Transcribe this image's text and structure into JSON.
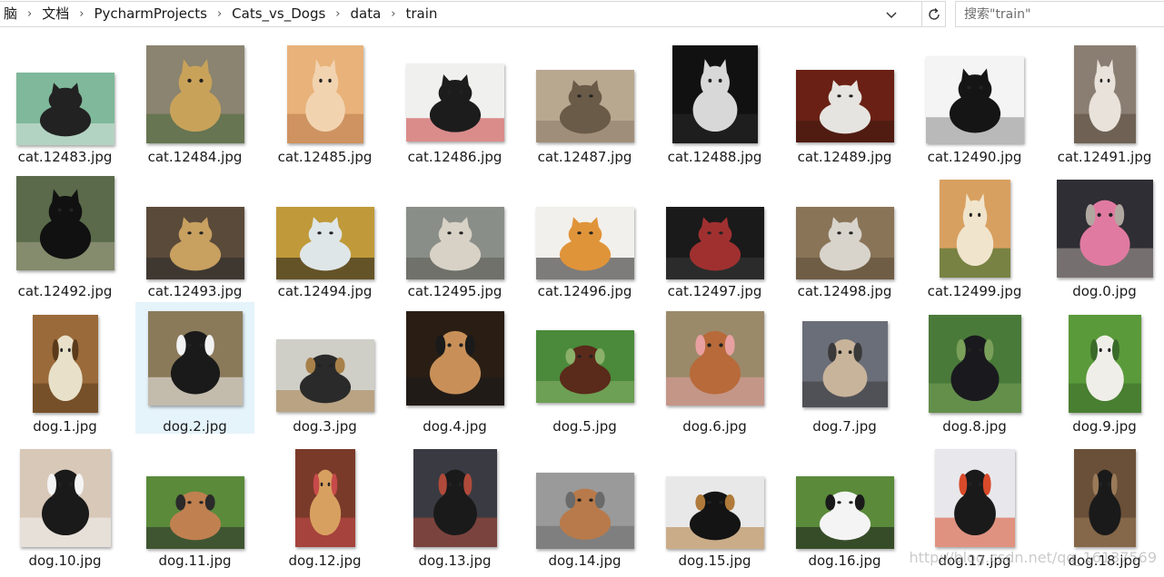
{
  "breadcrumb": [
    "脑",
    "文档",
    "PycharmProjects",
    "Cats_vs_Dogs",
    "data",
    "train"
  ],
  "search": {
    "placeholder": "搜索\"train\""
  },
  "watermark": "http://blog.csdn.net/qq_16137569",
  "colors": {
    "selection": "#e5f3fb",
    "border": "#d9d9d9",
    "background": "#ffffff"
  },
  "files": [
    {
      "name": "cat.12483.jpg",
      "palette": [
        "#7fb89a",
        "#222222",
        "#dfe9e4"
      ]
    },
    {
      "name": "cat.12484.jpg",
      "palette": [
        "#8a8470",
        "#c9a25a",
        "#4a6a3a"
      ]
    },
    {
      "name": "cat.12485.jpg",
      "palette": [
        "#e8b27a",
        "#f2d3b0",
        "#b87a4a"
      ]
    },
    {
      "name": "cat.12486.jpg",
      "palette": [
        "#f0f0ee",
        "#1c1c1c",
        "#c83a3a"
      ]
    },
    {
      "name": "cat.12487.jpg",
      "palette": [
        "#b8a890",
        "#6a5a48",
        "#8a7a68"
      ]
    },
    {
      "name": "cat.12488.jpg",
      "palette": [
        "#111111",
        "#d8d8d8",
        "#2a2a2a"
      ]
    },
    {
      "name": "cat.12489.jpg",
      "palette": [
        "#6a2014",
        "#e6e4e0",
        "#3a1a10"
      ]
    },
    {
      "name": "cat.12490.jpg",
      "palette": [
        "#f4f4f4",
        "#151515",
        "#888888"
      ]
    },
    {
      "name": "cat.12491.jpg",
      "palette": [
        "#8a7e72",
        "#e8e2da",
        "#5a4a3e"
      ]
    },
    {
      "name": "cat.12492.jpg",
      "palette": [
        "#5a6a4a",
        "#111111",
        "#a9a58a"
      ]
    },
    {
      "name": "cat.12493.jpg",
      "palette": [
        "#5a4a3a",
        "#c8a060",
        "#2a2a2a"
      ]
    },
    {
      "name": "cat.12494.jpg",
      "palette": [
        "#c09a3a",
        "#dfe6e8",
        "#1a1a1a"
      ]
    },
    {
      "name": "cat.12495.jpg",
      "palette": [
        "#8a8e88",
        "#d8d2c6",
        "#5a5a52"
      ]
    },
    {
      "name": "cat.12496.jpg",
      "palette": [
        "#f2f0ec",
        "#e0943a",
        "#1e1e1e"
      ]
    },
    {
      "name": "cat.12497.jpg",
      "palette": [
        "#1a1a1a",
        "#a03030",
        "#3a3a3a"
      ]
    },
    {
      "name": "cat.12498.jpg",
      "palette": [
        "#8a7458",
        "#d8d4cc",
        "#5a4a36"
      ]
    },
    {
      "name": "cat.12499.jpg",
      "palette": [
        "#d8a060",
        "#f0e4cc",
        "#2a6a2a"
      ]
    },
    {
      "name": "dog.0.jpg",
      "palette": [
        "#2e2e34",
        "#e07aa0",
        "#b0a8a0"
      ]
    },
    {
      "name": "dog.1.jpg",
      "palette": [
        "#9a6a3a",
        "#e8e0c8",
        "#5a3a1a"
      ]
    },
    {
      "name": "dog.2.jpg",
      "palette": [
        "#8a7a5a",
        "#1a1a1a",
        "#f2f2f2"
      ]
    },
    {
      "name": "dog.3.jpg",
      "palette": [
        "#cfcfc8",
        "#2a2a2a",
        "#a8804a"
      ]
    },
    {
      "name": "dog.4.jpg",
      "palette": [
        "#2a1e14",
        "#c89058",
        "#1a1a1a"
      ]
    },
    {
      "name": "dog.5.jpg",
      "palette": [
        "#4a8a3a",
        "#5a2a1a",
        "#8ab06a"
      ]
    },
    {
      "name": "dog.6.jpg",
      "palette": [
        "#9a8a6a",
        "#b86a3a",
        "#e8a0a0"
      ]
    },
    {
      "name": "dog.7.jpg",
      "palette": [
        "#6a6e78",
        "#c8b49a",
        "#3a3a3a"
      ]
    },
    {
      "name": "dog.8.jpg",
      "palette": [
        "#4a7a3a",
        "#1a1a1e",
        "#7aa05a"
      ]
    },
    {
      "name": "dog.9.jpg",
      "palette": [
        "#5a9a3a",
        "#f0eee8",
        "#3a6a2a"
      ]
    },
    {
      "name": "dog.10.jpg",
      "palette": [
        "#d8c8b8",
        "#1a1a1a",
        "#f4f4f4"
      ]
    },
    {
      "name": "dog.11.jpg",
      "palette": [
        "#5a8a3a",
        "#c08050",
        "#2a2a2a"
      ]
    },
    {
      "name": "dog.12.jpg",
      "palette": [
        "#7a3a2a",
        "#d8a060",
        "#c84a4a"
      ]
    },
    {
      "name": "dog.13.jpg",
      "palette": [
        "#3a3a42",
        "#1a1a1a",
        "#b04a3a"
      ]
    },
    {
      "name": "dog.14.jpg",
      "palette": [
        "#9a9a9a",
        "#b87a4a",
        "#6a6a6a"
      ]
    },
    {
      "name": "dog.15.jpg",
      "palette": [
        "#e8e8e8",
        "#141414",
        "#b07a3a"
      ]
    },
    {
      "name": "dog.16.jpg",
      "palette": [
        "#5a8a3a",
        "#f4f4f4",
        "#1a1a1a"
      ]
    },
    {
      "name": "dog.17.jpg",
      "palette": [
        "#e8e8ec",
        "#1a1a1a",
        "#d84a2a"
      ]
    },
    {
      "name": "dog.18.jpg",
      "palette": [
        "#6a5038",
        "#1a1a1a",
        "#9a7a58"
      ]
    }
  ]
}
